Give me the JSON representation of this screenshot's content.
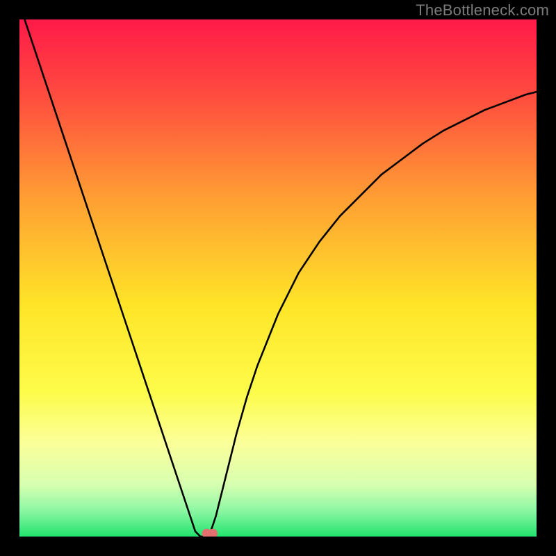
{
  "watermark": "TheBottleneck.com",
  "chart_data": {
    "type": "line",
    "title": "",
    "xlabel": "",
    "ylabel": "",
    "xlim": [
      0,
      100
    ],
    "ylim": [
      0,
      100
    ],
    "grid": false,
    "legend": false,
    "background": {
      "kind": "vertical-gradient",
      "stops": [
        {
          "offset": 0.0,
          "color": "#ff1a49"
        },
        {
          "offset": 0.15,
          "color": "#ff4d3f"
        },
        {
          "offset": 0.35,
          "color": "#ffa033"
        },
        {
          "offset": 0.55,
          "color": "#ffe428"
        },
        {
          "offset": 0.72,
          "color": "#fdfc4a"
        },
        {
          "offset": 0.82,
          "color": "#fbff9a"
        },
        {
          "offset": 0.9,
          "color": "#d6ffb0"
        },
        {
          "offset": 0.95,
          "color": "#8cf7a3"
        },
        {
          "offset": 1.0,
          "color": "#22e36e"
        }
      ]
    },
    "series": [
      {
        "name": "bottleneck-curve",
        "color": "#000000",
        "stroke_width": 2.6,
        "x": [
          1,
          3,
          5,
          7,
          9,
          11,
          13,
          15,
          17,
          19,
          21,
          23,
          25,
          27,
          29,
          31,
          33,
          34,
          35,
          36,
          37,
          38,
          40,
          42,
          44,
          46,
          48,
          50,
          54,
          58,
          62,
          66,
          70,
          74,
          78,
          82,
          86,
          90,
          94,
          98,
          100
        ],
        "y": [
          100,
          94,
          88,
          82,
          76,
          70,
          64,
          58,
          52,
          46,
          40,
          34,
          28,
          22,
          16,
          10,
          4,
          1,
          0,
          0,
          1,
          4,
          12,
          20,
          27,
          33,
          38,
          43,
          51,
          57,
          62,
          66,
          70,
          73,
          76,
          78.5,
          80.5,
          82.5,
          84,
          85.5,
          86
        ]
      }
    ],
    "markers": [
      {
        "name": "marker-dot",
        "x": 36.2,
        "y": 0.6,
        "color": "#e36f6f",
        "radius": 6.8
      },
      {
        "name": "marker-dot",
        "x": 37.4,
        "y": 0.6,
        "color": "#e36f6f",
        "radius": 6.8
      }
    ]
  }
}
